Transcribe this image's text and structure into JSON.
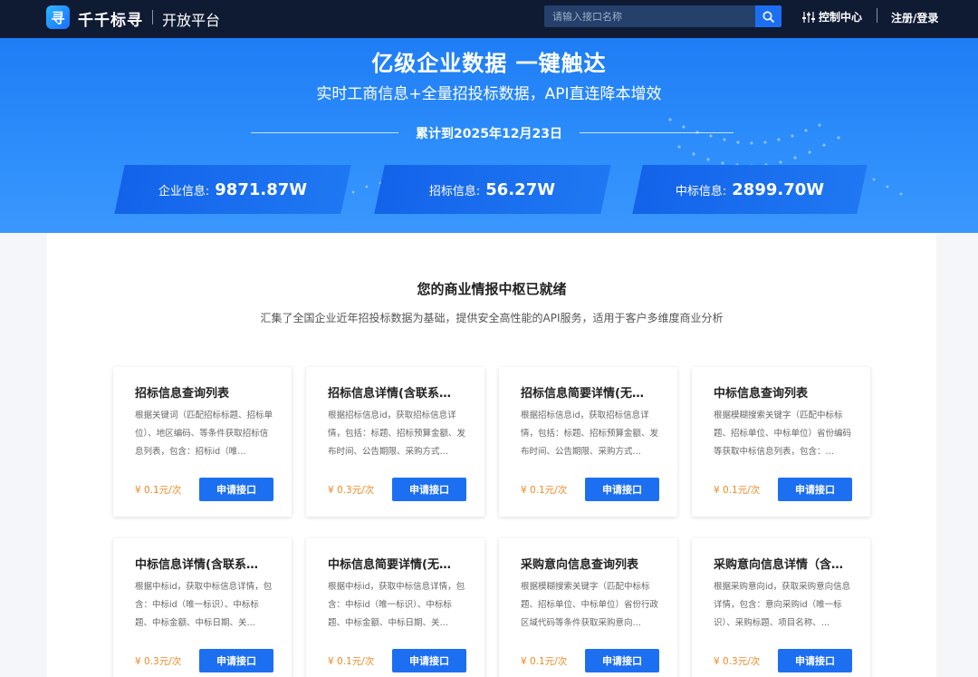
{
  "header": {
    "brand": "千千标寻",
    "platform": "开放平台",
    "search_placeholder": "请输入接口名称",
    "control_center": "控制中心",
    "login": "注册/登录"
  },
  "banner": {
    "title": "亿级企业数据 一键触达",
    "subtitle": "实时工商信息+全量招投标数据，API直连降本增效",
    "date_text": "累计到2025年12月23日",
    "stats": [
      {
        "label": "企业信息:",
        "value": "9871.87W"
      },
      {
        "label": "招标信息:",
        "value": "56.27W"
      },
      {
        "label": "中标信息:",
        "value": "2899.70W"
      }
    ]
  },
  "section": {
    "title": "您的商业情报中枢已就绪",
    "description": "汇集了全国企业近年招投标数据为基础，提供安全高性能的API服务，适用于客户多维度商业分析"
  },
  "cards": [
    {
      "title": "招标信息查询列表",
      "desc": "根据关键词（匹配招标标题、招标单位）、地区编码、等条件获取招标信息列表，包含：招标id（唯…",
      "price": "¥ 0.1元/次",
      "button": "申请接口"
    },
    {
      "title": "招标信息详情(含联系…",
      "desc": "根据招标信息id，获取招标信息详情，包括：标题、招标预算金额、发布时间、公告期限、采购方式…",
      "price": "¥ 0.3元/次",
      "button": "申请接口"
    },
    {
      "title": "招标信息简要详情(无…",
      "desc": "根据招标信息id，获取招标信息详情，包括：标题、招标预算金额、发布时间、公告期限、采购方式…",
      "price": "¥ 0.1元/次",
      "button": "申请接口"
    },
    {
      "title": "中标信息查询列表",
      "desc": "根据模糊搜索关键字（匹配中标标题、招标单位、中标单位）省份编码等获取中标信息列表，包含：…",
      "price": "¥ 0.1元/次",
      "button": "申请接口"
    },
    {
      "title": "中标信息详情(含联系…",
      "desc": "根据中标id，获取中标信息详情，包含：中标id（唯一标识）、中标标题、中标金额、中标日期、关…",
      "price": "¥ 0.3元/次",
      "button": "申请接口"
    },
    {
      "title": "中标信息简要详情(无…",
      "desc": "根据中标id，获取中标信息详情，包含：中标id（唯一标识）、中标标题、中标金额、中标日期、关…",
      "price": "¥ 0.1元/次",
      "button": "申请接口"
    },
    {
      "title": "采购意向信息查询列表",
      "desc": "根据模糊搜索关键字（匹配中标标题、招标单位、中标单位）省份行政区域代码等条件获取采购意向…",
      "price": "¥ 0.1元/次",
      "button": "申请接口"
    },
    {
      "title": "采购意向信息详情（含…",
      "desc": "根据采购意向id，获取采购意向信息详情，包含：意向采购id（唯一标识）、采购标题、项目名称、…",
      "price": "¥ 0.3元/次",
      "button": "申请接口"
    }
  ],
  "colors": {
    "header_bg": "#0f1b33",
    "banner_blue": "#2c8dfb",
    "accent": "#1d6ff2",
    "price": "#f08a24"
  },
  "icons": {
    "logo": "logo-search-icon",
    "search": "search-icon",
    "control": "sliders-icon"
  }
}
